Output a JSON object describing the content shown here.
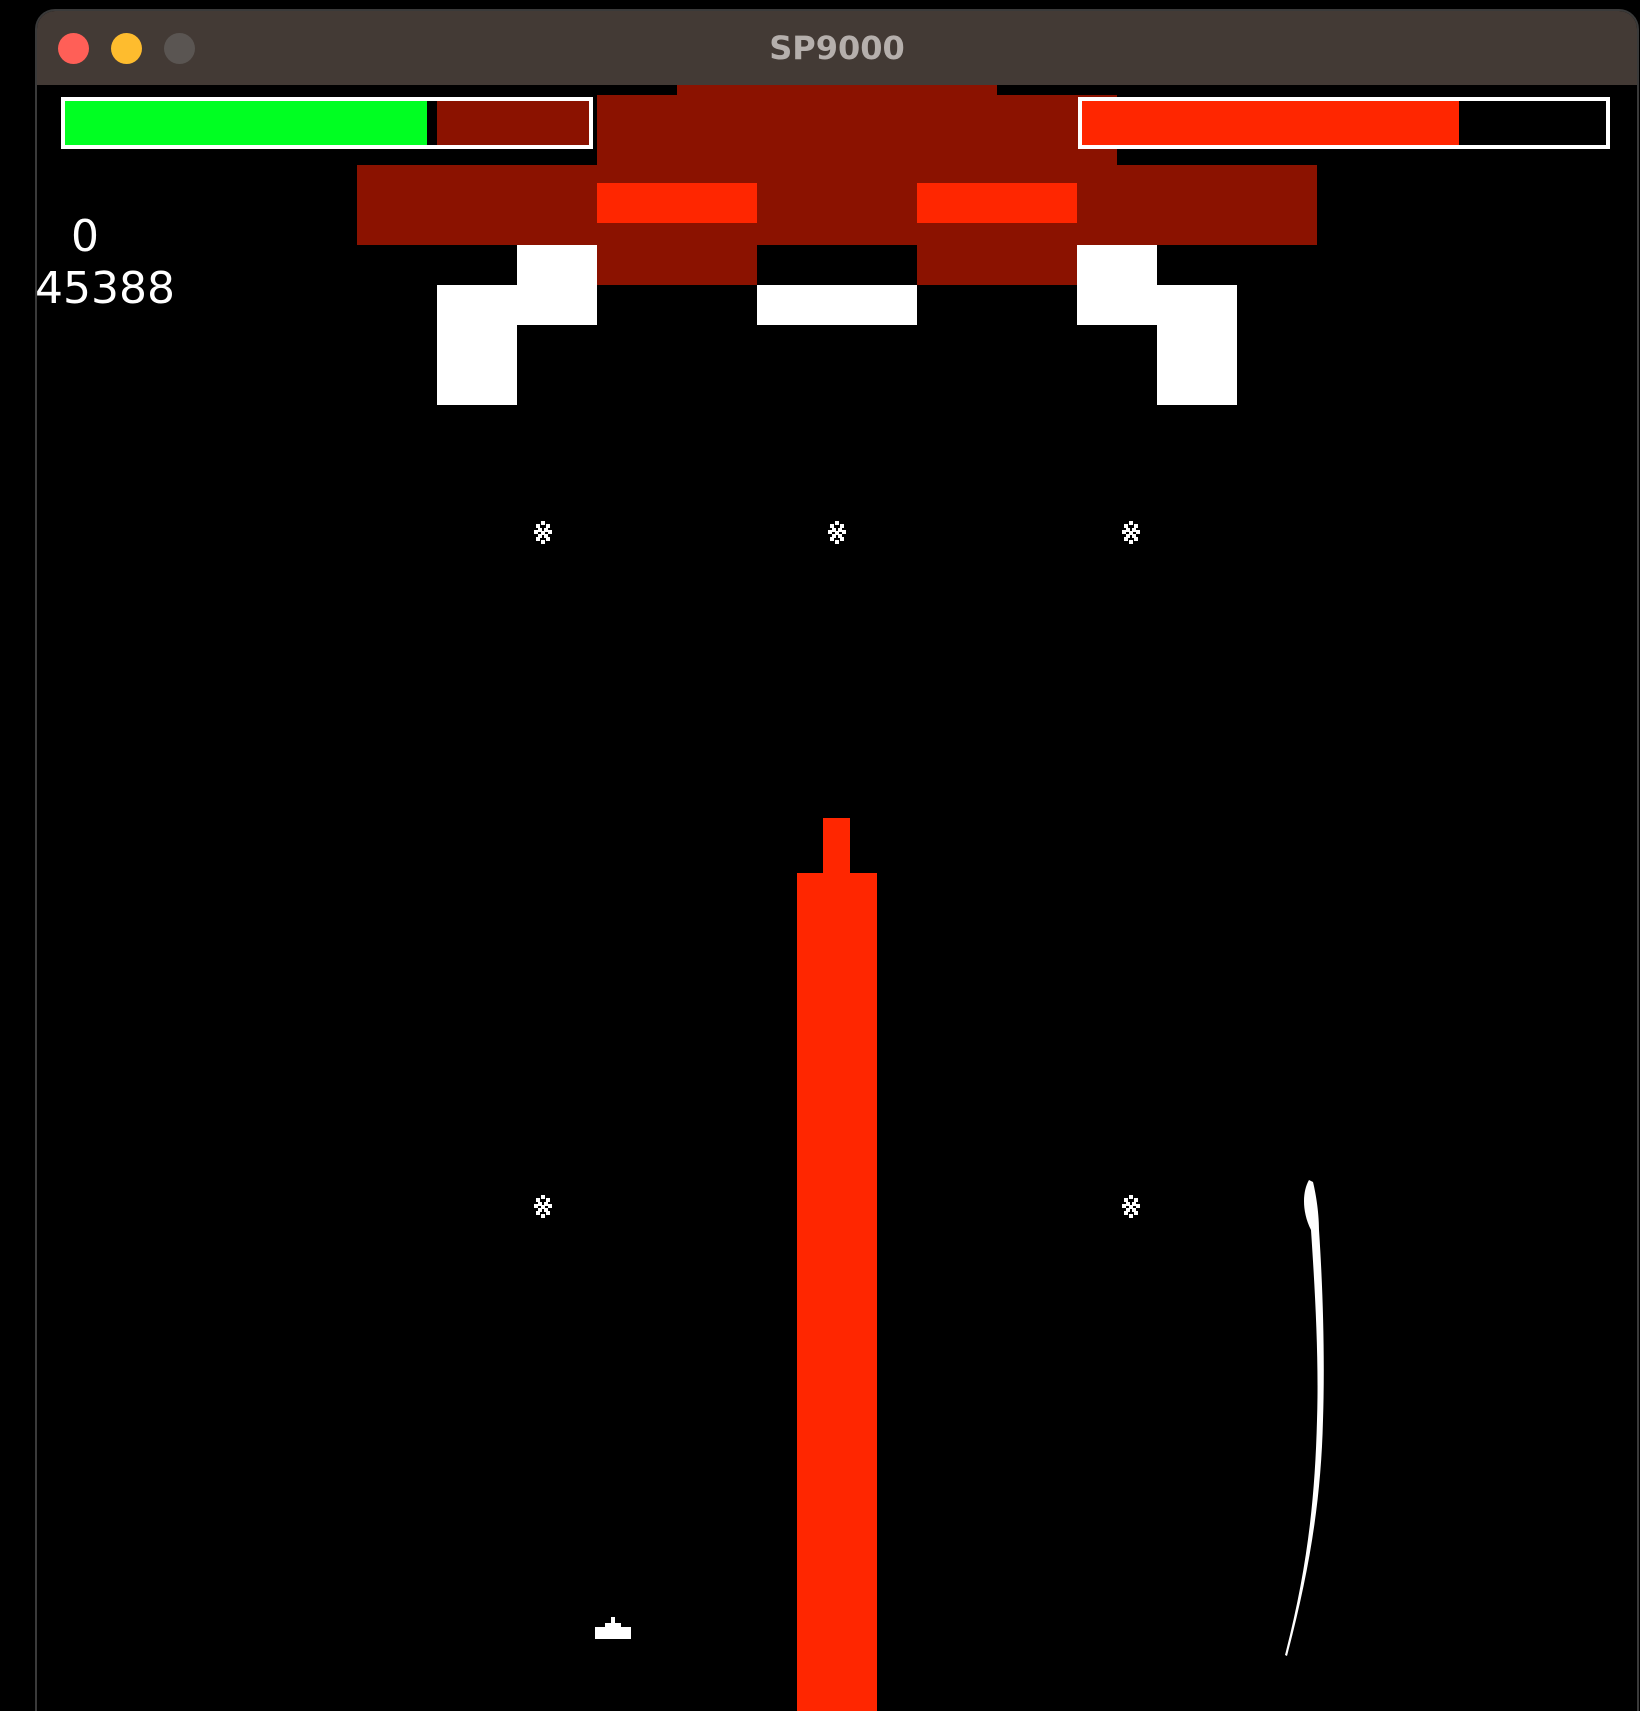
{
  "window": {
    "title": "SP9000",
    "traffic_lights": {
      "close_color": "#ff5f57",
      "minimize_color": "#febc2e",
      "zoom_color": "#5a5552"
    }
  },
  "hud": {
    "player_health": {
      "fraction": 0.69,
      "fill_color": "#00ff22",
      "remainder_color": "#8b1200"
    },
    "boss_health": {
      "fraction": 0.72,
      "fill_color": "#ff2600"
    },
    "score_top": "0",
    "score_bottom": "45388"
  },
  "colors": {
    "boss_body": "#8b1200",
    "boss_eye": "#ff2600",
    "boss_legs": "#ffffff",
    "laser": "#ff2600",
    "player_ship": "#ffffff",
    "bullet": "#ffffff"
  },
  "entities": {
    "boss": "boss-ship",
    "laser": "laser-beam",
    "player": "player-ship",
    "enemy_shots": [
      "enemy-shot",
      "enemy-shot",
      "enemy-shot",
      "enemy-shot",
      "enemy-shot"
    ],
    "trail": "curved-projectile-trail"
  }
}
